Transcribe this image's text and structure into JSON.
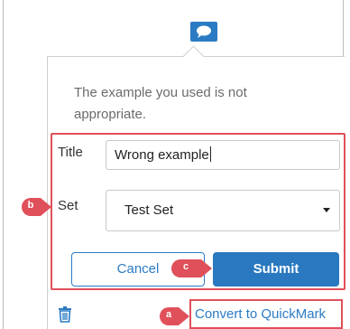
{
  "comment": {
    "text": "The example you used is not appropriate."
  },
  "form": {
    "title_label": "Title",
    "title_value": "Wrong example",
    "set_label": "Set",
    "set_value": "Test Set",
    "cancel_label": "Cancel",
    "submit_label": "Submit"
  },
  "footer": {
    "convert_label": "Convert to QuickMark"
  },
  "callouts": {
    "a": "a",
    "b": "b",
    "c": "c"
  },
  "colors": {
    "accent": "#2b7bc4",
    "submit_bg": "#2a78bf",
    "annotation_red": "#e0505a",
    "text_gray": "#6b6b6b"
  }
}
